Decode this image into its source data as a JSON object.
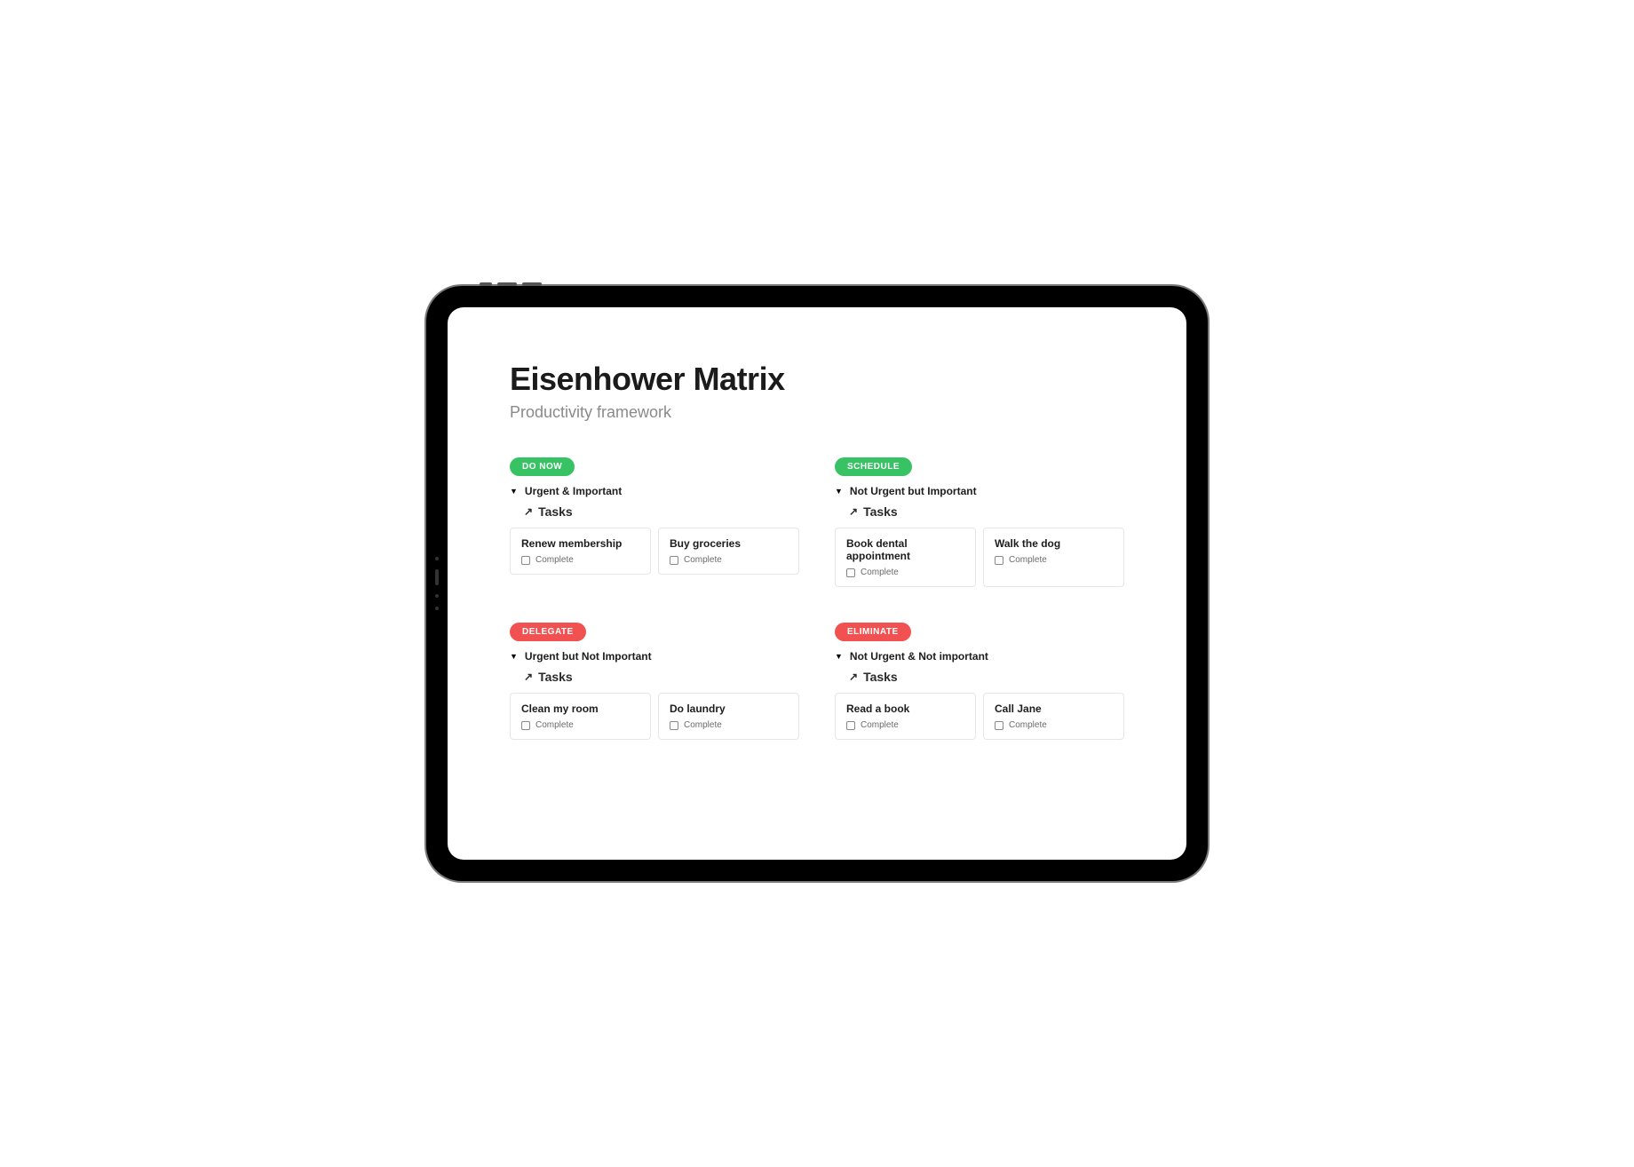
{
  "header": {
    "title": "Eisenhower Matrix",
    "subtitle": "Productivity framework"
  },
  "labels": {
    "tasks": "Tasks",
    "complete": "Complete"
  },
  "colors": {
    "green": "#37c263",
    "red": "#f15151"
  },
  "quadrants": [
    {
      "pill": "DO NOW",
      "pill_color": "green",
      "section": "Urgent & Important",
      "tasks": [
        {
          "title": "Renew membership"
        },
        {
          "title": "Buy groceries"
        }
      ]
    },
    {
      "pill": "SCHEDULE",
      "pill_color": "green",
      "section": "Not Urgent but Important",
      "tasks": [
        {
          "title": "Book dental appointment"
        },
        {
          "title": "Walk the dog"
        }
      ]
    },
    {
      "pill": "DELEGATE",
      "pill_color": "red",
      "section": "Urgent but Not Important",
      "tasks": [
        {
          "title": "Clean my room"
        },
        {
          "title": "Do laundry"
        }
      ]
    },
    {
      "pill": "ELIMINATE",
      "pill_color": "red",
      "section": "Not Urgent & Not important",
      "tasks": [
        {
          "title": "Read a book"
        },
        {
          "title": "Call Jane"
        }
      ]
    }
  ]
}
